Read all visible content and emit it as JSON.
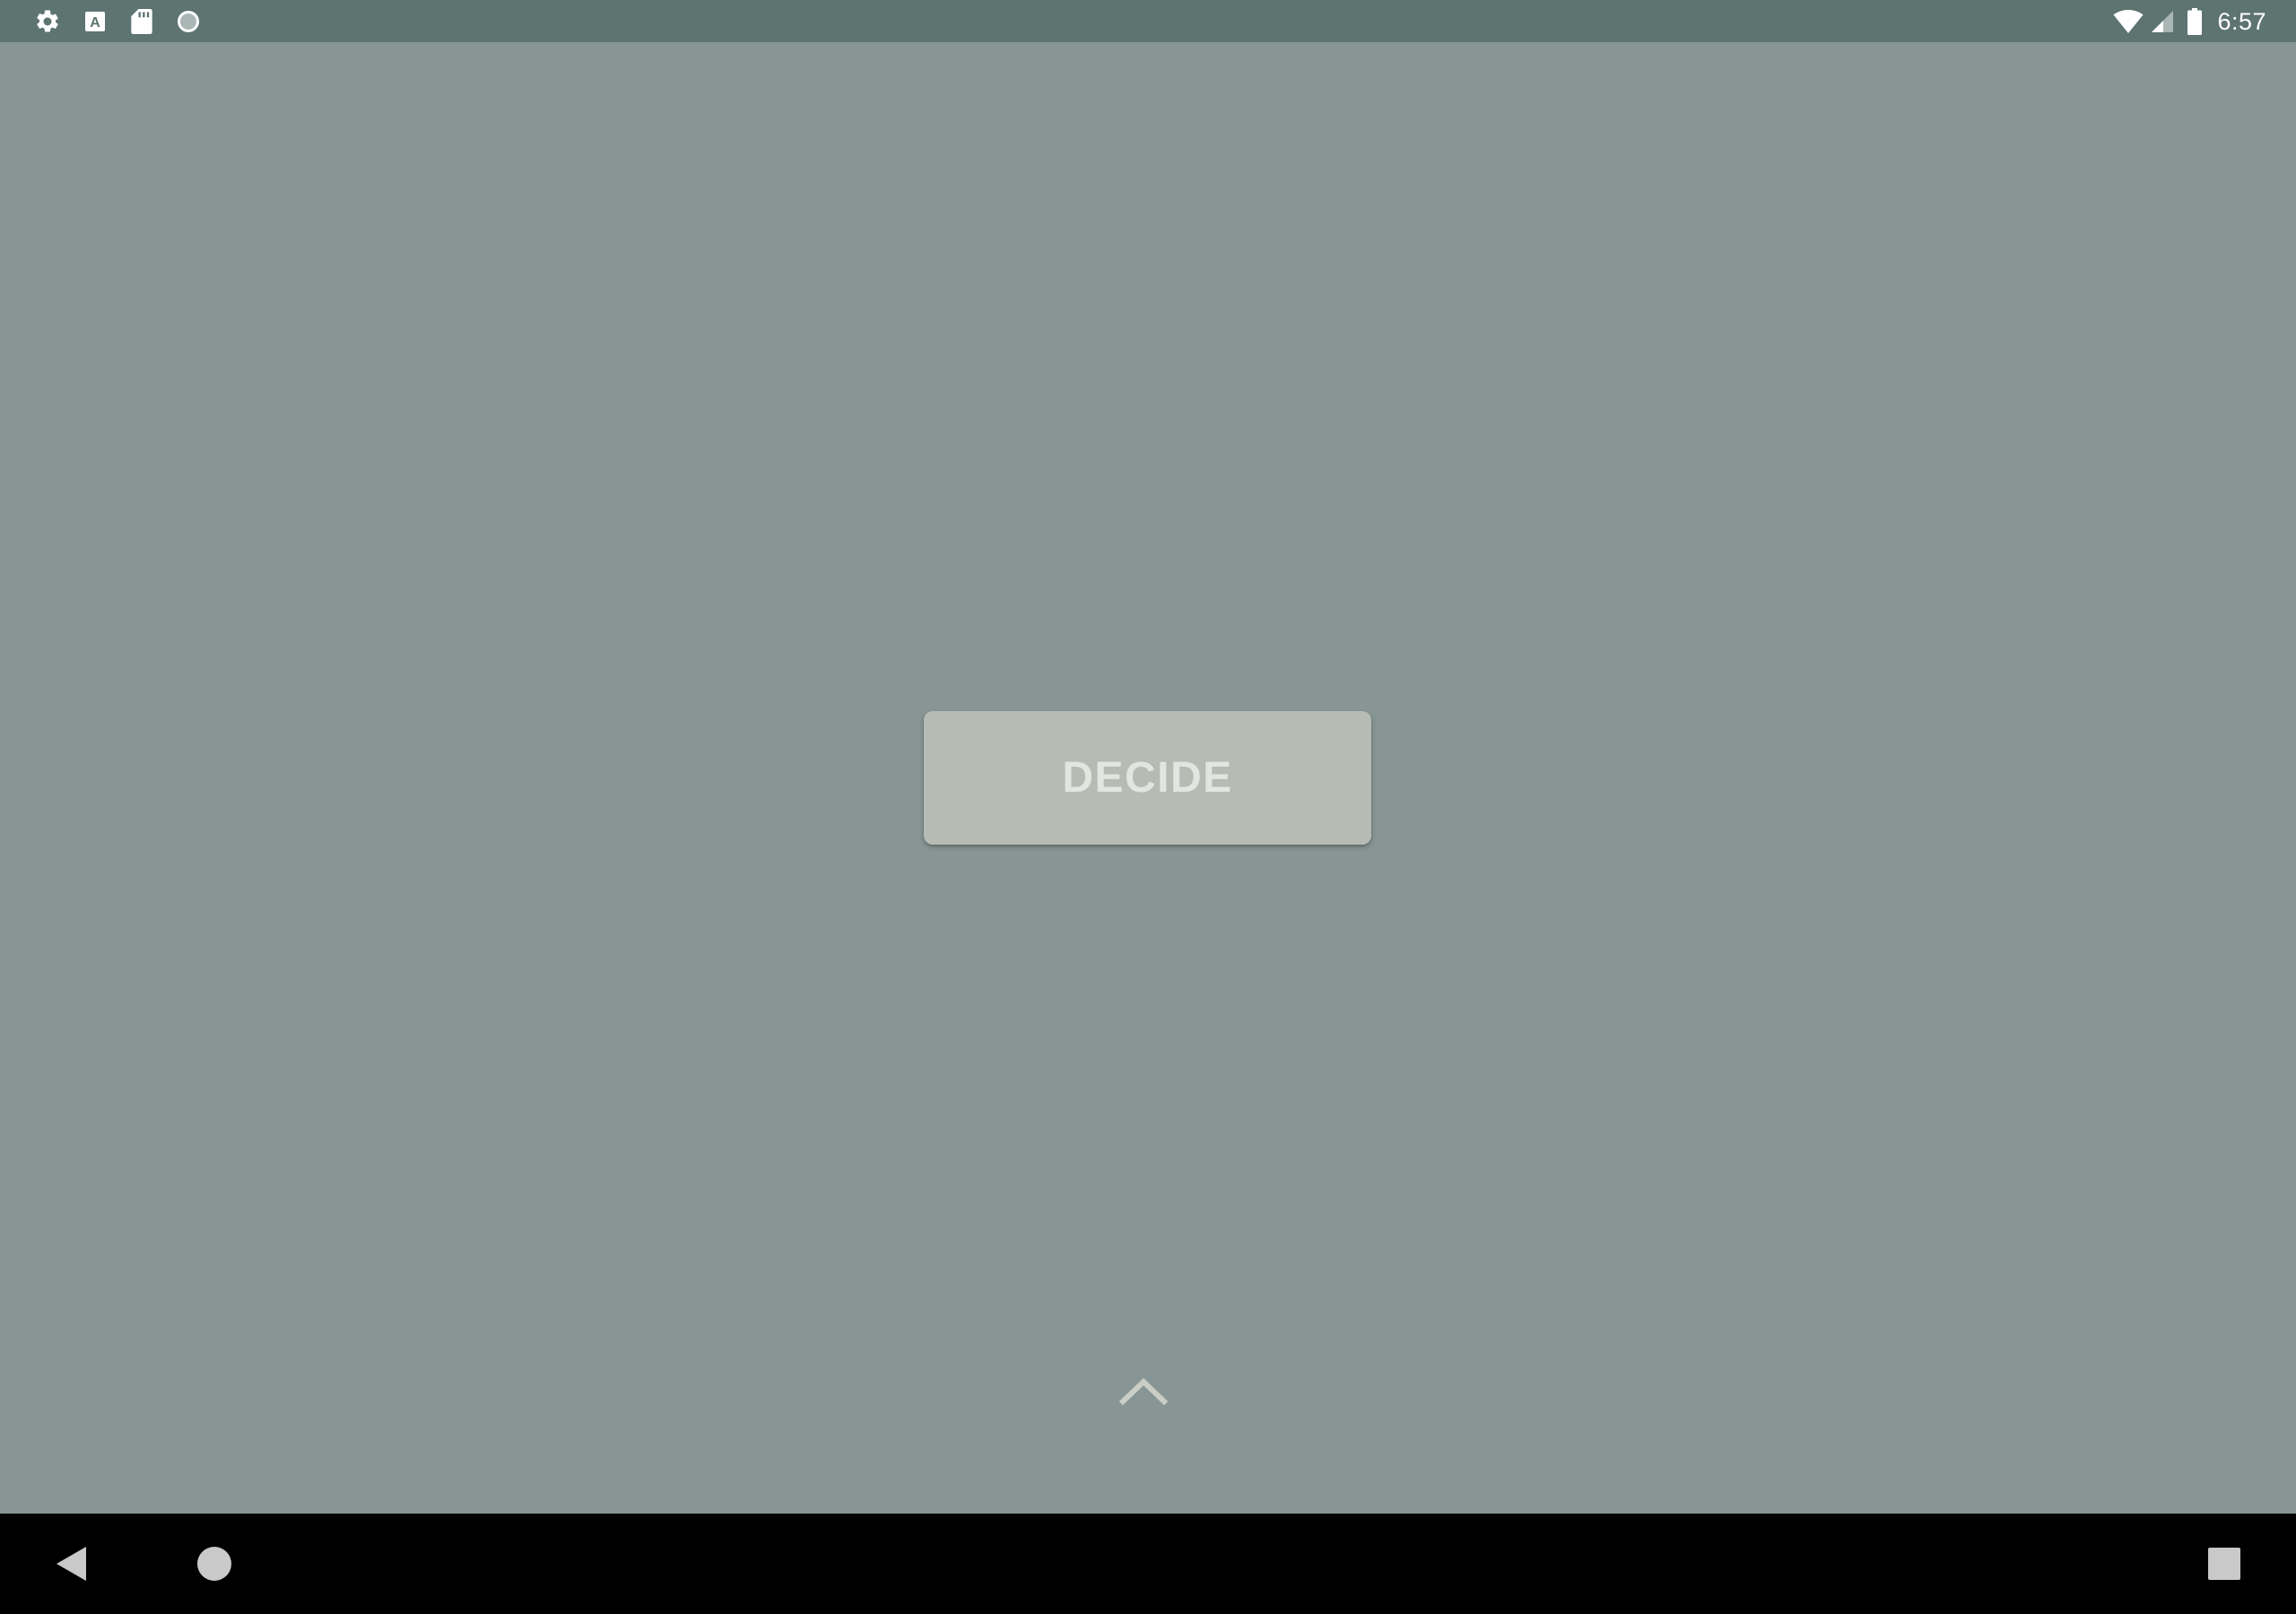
{
  "status_bar": {
    "left_icons": [
      "settings-icon",
      "text-a-icon",
      "sd-card-icon",
      "circle-icon"
    ],
    "right_icons": [
      "wifi-icon",
      "cell-signal-icon",
      "battery-icon"
    ],
    "time": "6:57"
  },
  "main": {
    "decide_button_label": "DECIDE",
    "expand_icon": "chevron-up-icon"
  },
  "nav_bar": {
    "buttons": [
      "back-icon",
      "home-icon",
      "recents-icon"
    ]
  },
  "colors": {
    "background": "#879695",
    "status_bar": "#5d7471",
    "button": "#b6bbb3",
    "button_text": "#e3e5e1",
    "nav_bar": "#000000"
  }
}
